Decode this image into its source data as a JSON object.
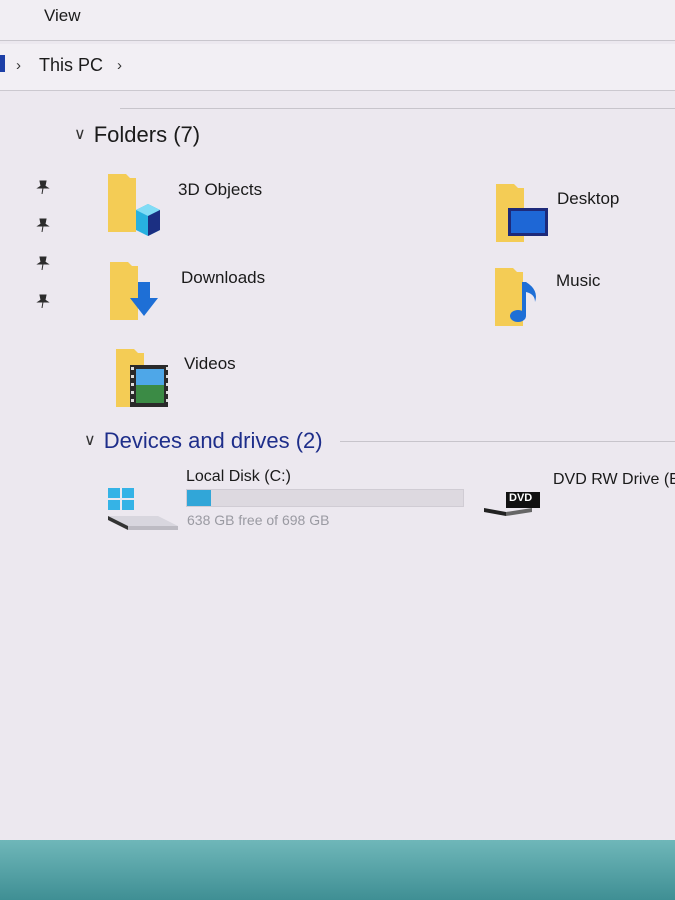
{
  "ribbon": {
    "view_label": "View"
  },
  "address": {
    "location": "This PC"
  },
  "folders_group": {
    "title": "Folders (7)",
    "items": [
      {
        "label": "3D Objects",
        "icon": "3d-objects-icon"
      },
      {
        "label": "Desktop",
        "icon": "desktop-icon"
      },
      {
        "label": "Downloads",
        "icon": "downloads-icon"
      },
      {
        "label": "Music",
        "icon": "music-icon"
      },
      {
        "label": "Videos",
        "icon": "videos-icon"
      }
    ]
  },
  "drives_group": {
    "title": "Devices and drives (2)",
    "drives": [
      {
        "label": "Local Disk (C:)",
        "space": "638 GB free of 698 GB",
        "used_fraction": 0.086,
        "icon": "windows-drive-icon"
      },
      {
        "label": "DVD RW Drive (E:)",
        "badge": "DVD",
        "icon": "dvd-drive-icon"
      }
    ]
  },
  "colors": {
    "accent": "#1e2e8a",
    "folder": "#f2c94c",
    "drive_fill": "#31a6d8"
  }
}
